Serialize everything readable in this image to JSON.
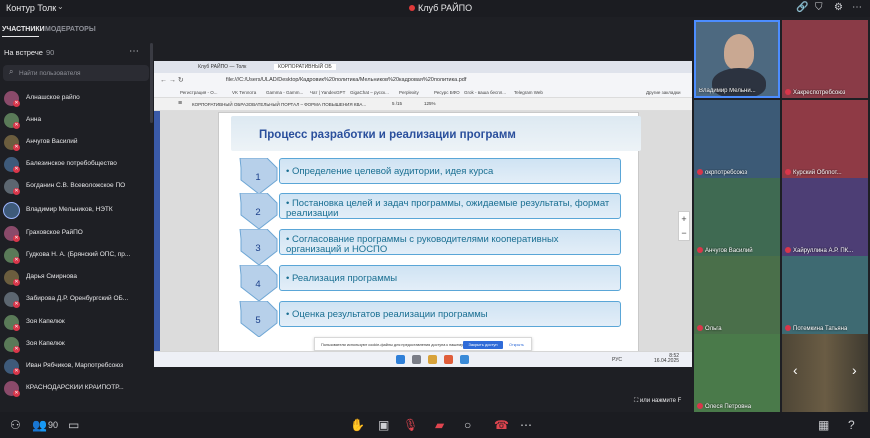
{
  "topbar": {
    "app_title": "Контур Толк",
    "meeting_title": "Клуб РАЙПО",
    "icons": [
      "link-icon",
      "shield-icon",
      "gear-icon",
      "more-icon"
    ]
  },
  "left_panel": {
    "tabs": [
      {
        "label": "УЧАСТНИКИ",
        "active": true
      },
      {
        "label": "МОДЕРАТОРЫ",
        "active": false
      }
    ],
    "section_title": "На встрече",
    "section_count": "90",
    "search_placeholder": "Найти пользователя",
    "participants": [
      "Алнашское райпо",
      "Анна",
      "Анчугов Василий",
      "Балезинское потребобщество",
      "Богданин С.В. Всеволожское ПО",
      "Владимир Мельников, НЭТК",
      "Граховское РайПО",
      "Гудкова Н. А. (Брянский ОПС, пр...",
      "Дарья Смирнова",
      "Забирова Д.Р. Оренбургский ОБ...",
      "Зоя Капелюк",
      "Зоя Капелюк",
      "Иван Рябчиков, Марпотребсоюз",
      "КРАСНОДАРСКИЙ КРАЙПОТР..."
    ]
  },
  "shared_screen": {
    "browser_tabs": [
      "Клуб РАЙПО — Толк",
      "КОРПОРАТИВНЫЙ ОБ"
    ],
    "address": "file:///C:/Users/ULAD/Desktop/Кадровик%20политика/Мельников%20кадровая%20политика.pdf",
    "bookmarks": [
      "Регистрация - О...",
      "VK Теплота",
      "Gamma - Gamm...",
      "Чат | YandexGPT",
      "GigaChat – русск...",
      "Perplexity",
      "Ресурс БФО",
      "Grok - ваша беспл...",
      "Telegram Web"
    ],
    "bookmarks_right": "Другие закладки",
    "pdf_title": "КОРПОРАТИВНЫЙ ОБРАЗОВАТЕЛЬНЫЙ ПОРТАЛ – ФОРМА ПОВЫШЕНИЯ КВА...",
    "pdf_page": "5",
    "pdf_pages_total": "/15",
    "pdf_zoom": "125%",
    "slide": {
      "title": "Процесс разработки и реализации программ",
      "steps": [
        {
          "num": "1",
          "text": "• Определение целевой аудитории, идея курса"
        },
        {
          "num": "2",
          "text": "• Постановка целей и задач программы, ожидаемые результаты, формат реализации"
        },
        {
          "num": "3",
          "text": "• Согласование программы с руководителями кооперативных организаций и НОСПО"
        },
        {
          "num": "4",
          "text": "• Реализация программы"
        },
        {
          "num": "5",
          "text": "• Оценка результатов реализации программы"
        }
      ]
    },
    "cookie_text": "Пользователи используют cookie-файлы для предоставления доступа к нашему журналу",
    "cookie_close": "Закрыть доступ",
    "cookie_open": "Открыть",
    "taskbar_lang": "РУС",
    "taskbar_time": "8:52",
    "taskbar_date": "16.04.2025"
  },
  "fullscreen_hint": "или нажмите F",
  "video_tiles": [
    {
      "name": "Владимир Мельни...",
      "muted": false,
      "selected": true
    },
    {
      "name": "Хакреспотребсоюз",
      "muted": true
    },
    {
      "name": "окрпотребсоюз",
      "muted": true
    },
    {
      "name": "Курский Облпот...",
      "muted": true
    },
    {
      "name": "Анчугов Василий",
      "muted": true
    },
    {
      "name": "Хайруллина А.Р. ПК...",
      "muted": true
    },
    {
      "name": "Ольга",
      "muted": true
    },
    {
      "name": "Потемкина Татьяна",
      "muted": true
    },
    {
      "name": "Олеся Петровна",
      "muted": true
    },
    {
      "name": "",
      "muted": false
    }
  ],
  "bottombar": {
    "participants_count": "90",
    "icons": [
      "participants-icon",
      "chat-icon",
      "raise-hand-icon",
      "screen-share-icon",
      "mic-off-icon",
      "camera-off-icon",
      "record-icon",
      "end-call-icon",
      "more-icon",
      "layout-icon",
      "help-icon"
    ]
  },
  "colors": {
    "accent_blue": "#4c8dff",
    "muted_red": "#d9364a",
    "slide_title": "#2a4f9c",
    "step_text": "#1a6f92"
  }
}
